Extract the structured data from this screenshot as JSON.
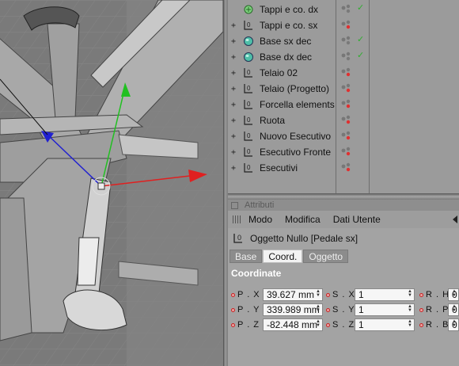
{
  "objects": [
    {
      "name": "Tappi e co. dx",
      "tree": "",
      "icon": "group-icon",
      "check": "✓"
    },
    {
      "name": "Tappi e co. sx",
      "tree": "+",
      "icon": "null-object-icon",
      "check": ""
    },
    {
      "name": "Base sx dec",
      "tree": "+",
      "icon": "sphere-icon",
      "check": "✓"
    },
    {
      "name": "Base dx dec",
      "tree": "+",
      "icon": "sphere-icon",
      "check": "✓"
    },
    {
      "name": "Telaio 02",
      "tree": "+",
      "icon": "null-object-icon",
      "check": ""
    },
    {
      "name": "Telaio (Progetto)",
      "tree": "+",
      "icon": "null-object-icon",
      "check": ""
    },
    {
      "name": "Forcella elements",
      "tree": "+",
      "icon": "null-object-icon",
      "check": ""
    },
    {
      "name": "Ruota",
      "tree": "+",
      "icon": "null-object-icon",
      "check": ""
    },
    {
      "name": "Nuovo Esecutivo",
      "tree": "+",
      "icon": "null-object-icon",
      "check": ""
    },
    {
      "name": "Esecutivo Fronte",
      "tree": "+",
      "icon": "null-object-icon",
      "check": ""
    },
    {
      "name": "Esecutivi",
      "tree": "+",
      "icon": "null-object-icon",
      "check": ""
    }
  ],
  "attributes": {
    "panel_title": "Attributi",
    "menu": [
      "Modo",
      "Modifica",
      "Dati Utente"
    ],
    "object_label": "Oggetto Nullo [Pedale sx]",
    "tabs": [
      "Base",
      "Coord.",
      "Oggetto"
    ],
    "active_tab": "Coord.",
    "section_title": "Coordinate",
    "rows": [
      {
        "pos_label": "P . X",
        "pos_value": "39.627 mm",
        "scale_label": "S . X",
        "scale_value": "1",
        "rot_label": "R . H",
        "rot_value": "0"
      },
      {
        "pos_label": "P . Y",
        "pos_value": "339.989 mm",
        "scale_label": "S . Y",
        "scale_value": "1",
        "rot_label": "R . P",
        "rot_value": "0"
      },
      {
        "pos_label": "P . Z",
        "pos_value": "-82.448 mm",
        "scale_label": "S . Z",
        "scale_value": "1",
        "rot_label": "R . B",
        "rot_value": "0"
      }
    ]
  },
  "colors": {
    "axis_x": "#e02020",
    "axis_y": "#20c020",
    "axis_z": "#2020d0",
    "checkmark": "#2fae2f",
    "render_dot_red": "#e03030"
  }
}
